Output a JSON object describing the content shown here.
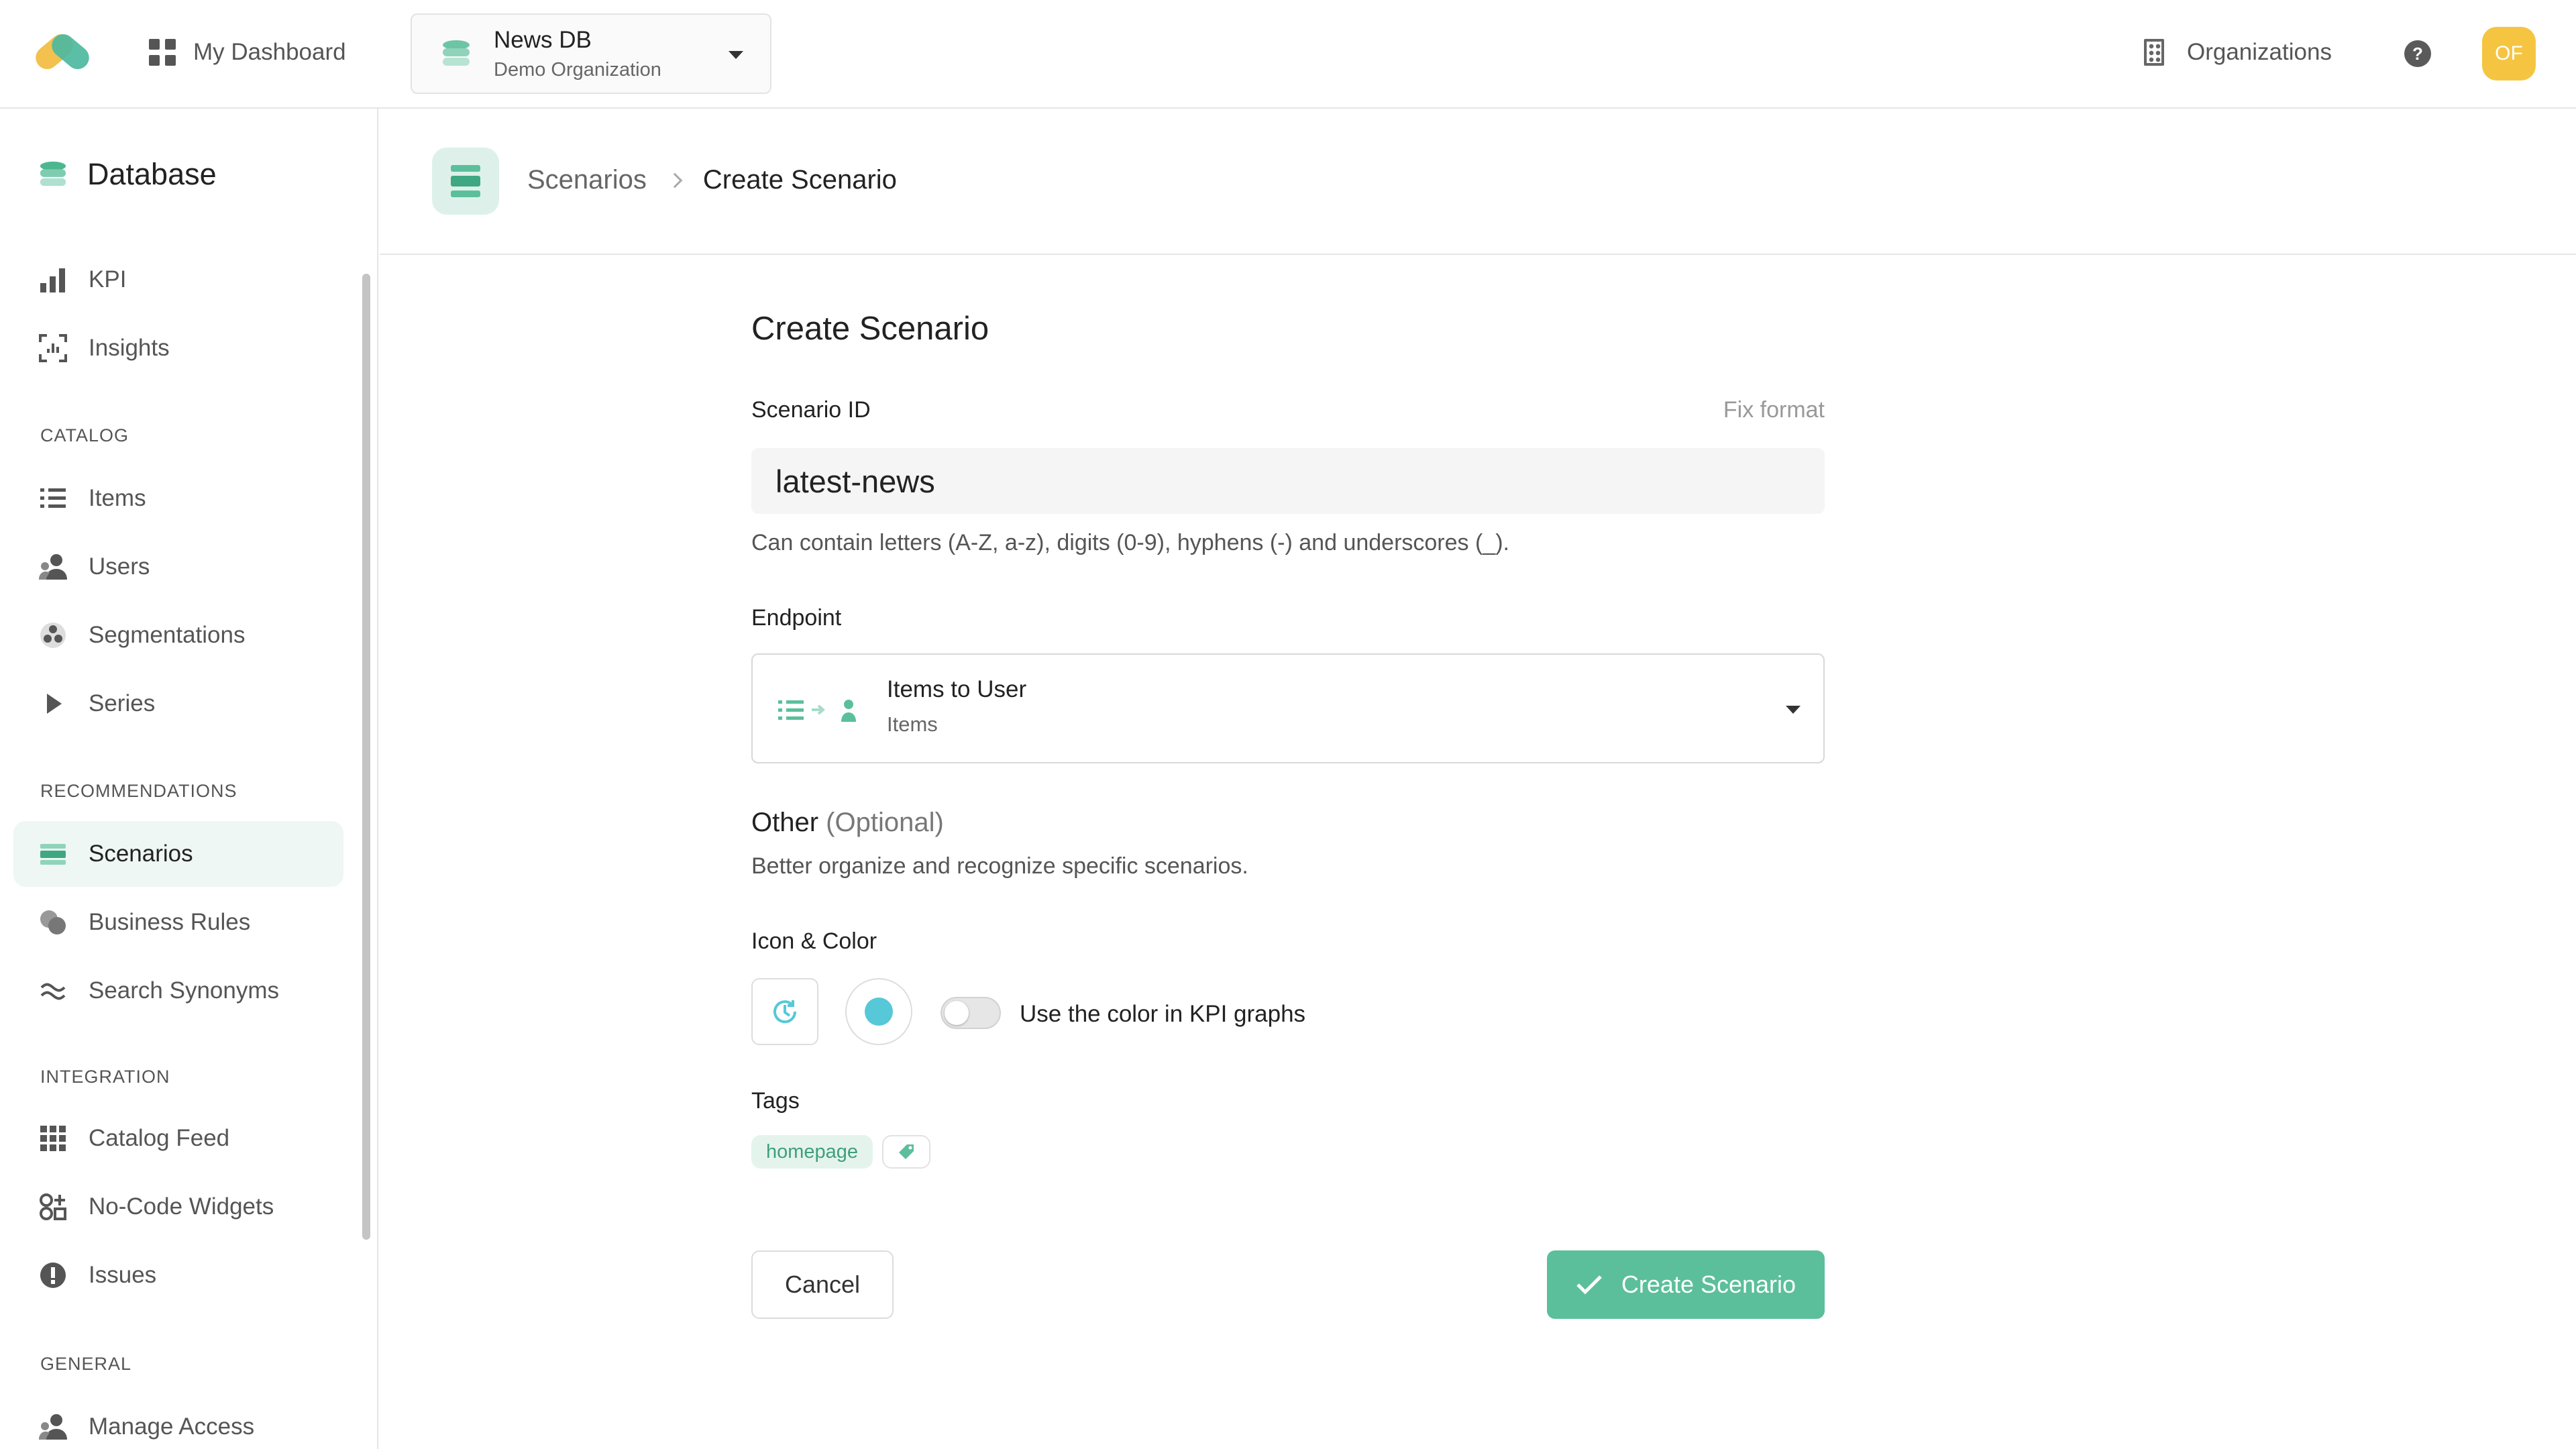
{
  "topbar": {
    "dashboard_label": "My Dashboard",
    "db_name": "News DB",
    "db_org": "Demo Organization",
    "organizations_label": "Organizations",
    "help_label": "?",
    "avatar_initials": "OF"
  },
  "sidebar": {
    "title": "Database",
    "items": {
      "kpi": "KPI",
      "insights": "Insights",
      "items": "Items",
      "users": "Users",
      "segmentations": "Segmentations",
      "series": "Series",
      "scenarios": "Scenarios",
      "business_rules": "Business Rules",
      "search_synonyms": "Search Synonyms",
      "catalog_feed": "Catalog Feed",
      "no_code_widgets": "No-Code Widgets",
      "issues": "Issues",
      "manage_access": "Manage Access"
    },
    "sections": {
      "catalog": "CATALOG",
      "recommendations": "RECOMMENDATIONS",
      "integration": "INTEGRATION",
      "general": "GENERAL"
    }
  },
  "breadcrumb": {
    "parent": "Scenarios",
    "current": "Create Scenario"
  },
  "form": {
    "title": "Create Scenario",
    "scenario_id_label": "Scenario ID",
    "fix_format": "Fix format",
    "scenario_id_value": "latest-news",
    "scenario_id_hint": "Can contain letters (A-Z, a-z), digits (0-9), hyphens (-) and underscores (_).",
    "endpoint_label": "Endpoint",
    "endpoint_value": "Items to User",
    "endpoint_sub": "Items",
    "other_label": "Other",
    "other_optional": "(Optional)",
    "other_desc": "Better organize and recognize specific scenarios.",
    "icon_color_label": "Icon & Color",
    "kpi_toggle_label": "Use the color in KPI graphs",
    "tags_label": "Tags",
    "tags": [
      "homepage"
    ],
    "cancel_label": "Cancel",
    "create_label": "Create Scenario"
  },
  "colors": {
    "accent": "#5bbf9b",
    "scenario_color": "#56c8d8",
    "avatar": "#f5c542"
  }
}
